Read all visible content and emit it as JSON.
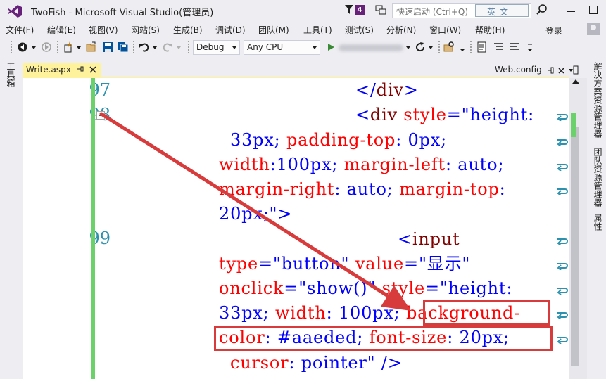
{
  "window": {
    "title": "TwoFish - Microsoft Visual Studio(管理员)",
    "notification_count": "4",
    "quick_launch_placeholder": "快速启动 (Ctrl+Q)",
    "ime_indicator": "英文"
  },
  "menu": {
    "items": [
      "文件(F)",
      "编辑(E)",
      "视图(V)",
      "网站(S)",
      "生成(B)",
      "调试(D)",
      "团队(M)",
      "工具(T)",
      "测试(S)",
      "分析(N)",
      "窗口(W)",
      "帮助(H)"
    ],
    "signin": "登录"
  },
  "toolbar": {
    "configuration": "Debug",
    "platform": "Any CPU"
  },
  "tabs": {
    "active": "Write.aspx",
    "other": "Web.config"
  },
  "side_panels": {
    "left": "工具箱",
    "right": [
      "解决方案资源管理器",
      "团队资源管理器",
      "属性"
    ]
  },
  "editor": {
    "line_numbers": [
      "97",
      "98",
      "99"
    ],
    "lines": [
      {
        "segments": [
          {
            "t": "</",
            "c": "punc"
          },
          {
            "t": "div",
            "c": "tag"
          },
          {
            "t": ">",
            "c": "punc"
          }
        ]
      },
      {
        "segments": [
          {
            "t": "<",
            "c": "punc"
          },
          {
            "t": "div",
            "c": "tag"
          },
          {
            "t": " ",
            "c": "tag"
          },
          {
            "t": "style",
            "c": "attr"
          },
          {
            "t": "=\"height:",
            "c": "val"
          }
        ]
      },
      {
        "segments": [
          {
            "t": "33px; ",
            "c": "val"
          },
          {
            "t": "padding-top",
            "c": "attr"
          },
          {
            "t": ": 0px;",
            "c": "val"
          }
        ]
      },
      {
        "segments": [
          {
            "t": "width",
            "c": "attr"
          },
          {
            "t": ":100px; ",
            "c": "val"
          },
          {
            "t": "margin-left",
            "c": "attr"
          },
          {
            "t": ": auto;",
            "c": "val"
          }
        ]
      },
      {
        "segments": [
          {
            "t": "margin-right",
            "c": "attr"
          },
          {
            "t": ": auto; ",
            "c": "val"
          },
          {
            "t": "margin-top",
            "c": "attr"
          },
          {
            "t": ":",
            "c": "val"
          }
        ]
      },
      {
        "segments": [
          {
            "t": "20px;\">",
            "c": "val"
          }
        ]
      },
      {
        "segments": [
          {
            "t": "<",
            "c": "punc"
          },
          {
            "t": "input",
            "c": "tag"
          }
        ]
      },
      {
        "segments": [
          {
            "t": "type",
            "c": "attr"
          },
          {
            "t": "=\"button\" ",
            "c": "val"
          },
          {
            "t": "value",
            "c": "attr"
          },
          {
            "t": "=\"显示\"",
            "c": "val"
          }
        ]
      },
      {
        "segments": [
          {
            "t": "onclick",
            "c": "attr"
          },
          {
            "t": "=\"show()\" ",
            "c": "val"
          },
          {
            "t": "style",
            "c": "attr"
          },
          {
            "t": "=\"height:",
            "c": "val"
          }
        ]
      },
      {
        "segments": [
          {
            "t": "33px; ",
            "c": "val"
          },
          {
            "t": "width",
            "c": "attr"
          },
          {
            "t": ": 100px; ",
            "c": "val"
          },
          {
            "t": "background-",
            "c": "attr"
          }
        ]
      },
      {
        "segments": [
          {
            "t": "color",
            "c": "attr"
          },
          {
            "t": ": #aaeded; ",
            "c": "val"
          },
          {
            "t": "font-size",
            "c": "attr"
          },
          {
            "t": ": 20px;",
            "c": "val"
          }
        ]
      },
      {
        "segments": [
          {
            "t": "cursor",
            "c": "attr"
          },
          {
            "t": ": pointer\" />",
            "c": "val"
          }
        ]
      }
    ]
  },
  "colors": {
    "accent": "#68217a",
    "active_tab": "#fff29d",
    "annotation_red": "#d83b3b",
    "change_bar": "#6bd26b",
    "line_number": "#2b91af"
  }
}
